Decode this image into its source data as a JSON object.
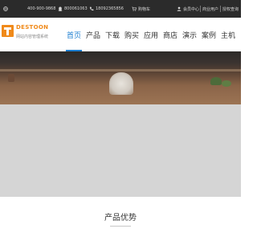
{
  "topbar": {
    "phone": "400-900-9868",
    "qq": "800061063",
    "mobile": "18092365856",
    "cart": "购物车",
    "member": "会员中心",
    "merchant": "商业用户",
    "auth": "授权查询"
  },
  "header": {
    "brand": "DESTOON",
    "tagline": "网站内容管理系统"
  },
  "nav": {
    "items": [
      "首页",
      "产品",
      "下载",
      "购买",
      "应用",
      "商店",
      "演示",
      "案例",
      "主机"
    ],
    "active_index": 0
  },
  "section": {
    "title": "产品优势"
  },
  "colors": {
    "accent": "#1e7fd0",
    "brand": "#f08a1a",
    "topbar": "#2b2b2b"
  },
  "icons": [
    "globe-icon",
    "qq-penguin-icon",
    "phone-icon",
    "cart-icon",
    "user-icon"
  ]
}
